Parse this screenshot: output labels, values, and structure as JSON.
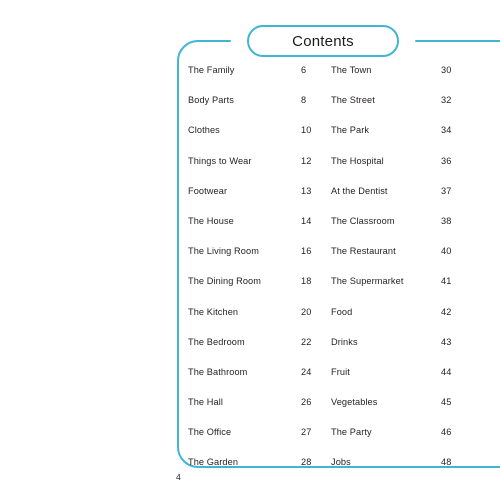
{
  "page": {
    "background_color": "#ffffff",
    "accent_color": "#40b6d4",
    "text_color": "#231f20",
    "folio": "4"
  },
  "header": {
    "title": "Contents"
  },
  "toc": {
    "columns": [
      {
        "name": "left-column",
        "entries": [
          {
            "label": "The Family",
            "page": "6"
          },
          {
            "label": "Body Parts",
            "page": "8"
          },
          {
            "label": "Clothes",
            "page": "10"
          },
          {
            "label": "Things to Wear",
            "page": "12"
          },
          {
            "label": "Footwear",
            "page": "13"
          },
          {
            "label": "The House",
            "page": "14"
          },
          {
            "label": "The Living Room",
            "page": "16"
          },
          {
            "label": "The Dining Room",
            "page": "18"
          },
          {
            "label": "The Kitchen",
            "page": "20"
          },
          {
            "label": "The Bedroom",
            "page": "22"
          },
          {
            "label": "The Bathroom",
            "page": "24"
          },
          {
            "label": "The Hall",
            "page": "26"
          },
          {
            "label": "The Office",
            "page": "27"
          },
          {
            "label": "The Garden",
            "page": "28"
          }
        ]
      },
      {
        "name": "right-column",
        "entries": [
          {
            "label": "The Town",
            "page": "30"
          },
          {
            "label": "The Street",
            "page": "32"
          },
          {
            "label": "The Park",
            "page": "34"
          },
          {
            "label": "The Hospital",
            "page": "36"
          },
          {
            "label": "At the Dentist",
            "page": "37"
          },
          {
            "label": "The Classroom",
            "page": "38"
          },
          {
            "label": "The Restaurant",
            "page": "40"
          },
          {
            "label": "The Supermarket",
            "page": "41"
          },
          {
            "label": "Food",
            "page": "42"
          },
          {
            "label": "Drinks",
            "page": "43"
          },
          {
            "label": "Fruit",
            "page": "44"
          },
          {
            "label": "Vegetables",
            "page": "45"
          },
          {
            "label": "The Party",
            "page": "46"
          },
          {
            "label": "Jobs",
            "page": "48"
          }
        ]
      }
    ]
  }
}
